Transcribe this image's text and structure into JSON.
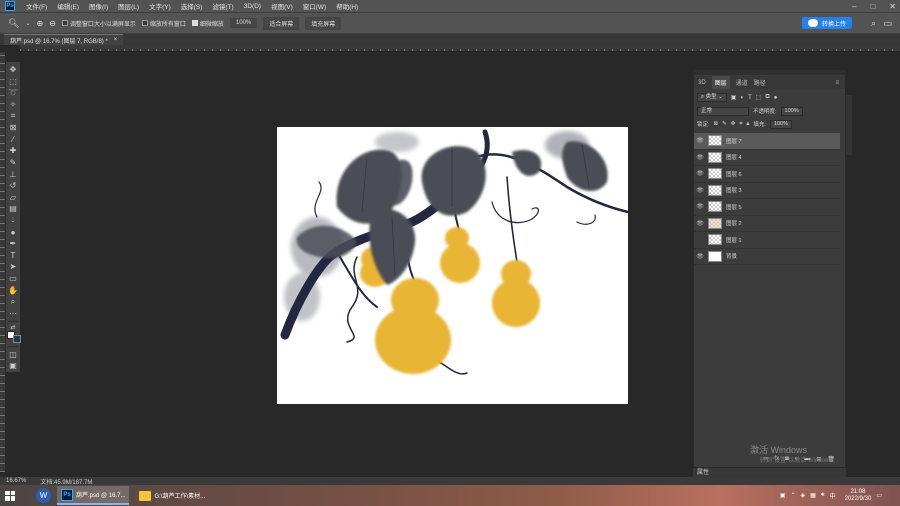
{
  "menubar": {
    "logo": "Ps",
    "items": [
      "文件(F)",
      "编辑(E)",
      "图像(I)",
      "图层(L)",
      "文字(Y)",
      "选择(S)",
      "滤镜(T)",
      "3D(D)",
      "视图(V)",
      "窗口(W)",
      "帮助(H)"
    ]
  },
  "options": {
    "check1": "调整窗口大小以满屏显示",
    "check2": "缩放所有窗口",
    "check3": "细微缩放",
    "zoom_value": "100%",
    "fit_screen": "适合屏幕",
    "fill_screen": "填充屏幕",
    "cloud_label": "转换上传"
  },
  "document": {
    "tab_title": "葫芦.psd @ 16.7% (图层 7, RGB/8) *",
    "close": "×"
  },
  "panel": {
    "tabs": [
      "3D",
      "图层",
      "通道",
      "路径"
    ],
    "filter_label": "类型",
    "blend_mode": "正常",
    "opacity_label": "不透明度:",
    "opacity_value": "100%",
    "lock_label": "锁定:",
    "fill_label": "填充:",
    "fill_value": "100%",
    "layers": [
      {
        "name": "图层 7",
        "visible": true
      },
      {
        "name": "图层 4",
        "visible": true
      },
      {
        "name": "图层 6",
        "visible": true
      },
      {
        "name": "图层 3",
        "visible": true
      },
      {
        "name": "图层 5",
        "visible": true
      },
      {
        "name": "图层 2",
        "visible": true
      },
      {
        "name": "图层 1",
        "visible": false
      },
      {
        "name": "背景",
        "visible": true
      }
    ],
    "bottom_tab": "属性"
  },
  "watermark": {
    "line1": "激活 Windows",
    "line2": "转到\"设置\"以激活 Windows。"
  },
  "status": {
    "zoom": "16.67%",
    "doc_info": "文档:45.9M/187.7M"
  },
  "taskbar": {
    "app1": "葫芦.psd @ 16.7...",
    "app2": "G:\\葫芦工作\\素材...",
    "time": "21:08",
    "date": "2022/9/30"
  },
  "colors": {
    "gourd": "#e8b535",
    "leaf": "#4a4d55",
    "vine": "#2a2d40"
  }
}
